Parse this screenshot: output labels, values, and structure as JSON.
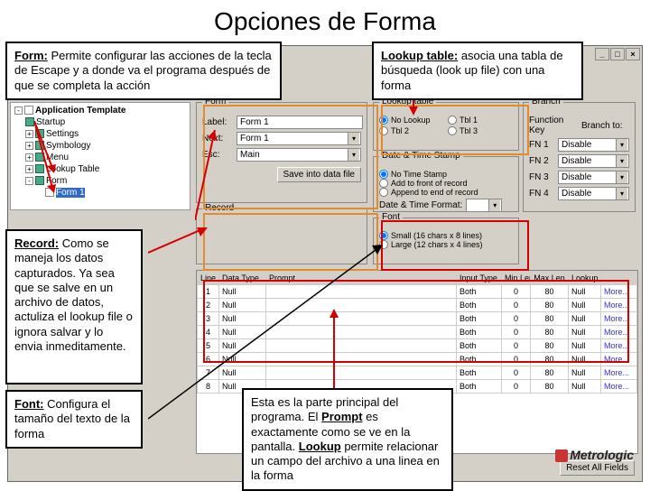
{
  "title": "Opciones de Forma",
  "callouts": {
    "form": {
      "head": "Form:",
      "body": " Permite configurar las acciones de la tecla de Escape y a donde va el programa después de que se completa la acción"
    },
    "lookup": {
      "head": "Lookup table:",
      "body": " asocia una tabla de búsqueda (look up file) con una forma"
    },
    "record": {
      "head": "Record:",
      "body": " Como se maneja los datos capturados. Ya sea que se salve en un archivo de datos, actuliza el lookup file o ignora salvar y lo envia inmeditamente."
    },
    "font": {
      "head": "Font:",
      "body": " Configura el tamaño del texto de la forma"
    },
    "main": {
      "body1": "Esta es la parte principal del programa. El ",
      "b1": "Prompt",
      "body2": " es exactamente como se ve en la pantalla. ",
      "b2": "Lookup",
      "body3": " permite relacionar un campo del archivo a una linea en la forma"
    }
  },
  "tree": {
    "root": "Application Template",
    "items": [
      "Startup",
      "Settings",
      "Symbology",
      "Menu",
      "Lookup Table",
      "Form"
    ],
    "selected": "Form 1"
  },
  "form_group": {
    "legend": "Form",
    "label_row": {
      "lbl": "Label:",
      "val": "Form 1"
    },
    "next_row": {
      "lbl": "Next:",
      "val": "Form 1"
    },
    "esc_row": {
      "lbl": "Esc:",
      "val": "Main"
    },
    "save_btn": "Save into data file"
  },
  "lookup_group": {
    "legend": "Lookup table",
    "opts": [
      "No Lookup",
      "Tbl 1",
      "Tbl 2",
      "Tbl 3"
    ]
  },
  "branch_group": {
    "legend": "Branch",
    "hdr_key": "Function Key",
    "hdr_br": "Branch to:",
    "rows": [
      [
        "FN 1",
        "Disable"
      ],
      [
        "FN 2",
        "Disable"
      ],
      [
        "FN 3",
        "Disable"
      ],
      [
        "FN 4",
        "Disable"
      ]
    ]
  },
  "dt_group": {
    "legend": "Date & Time Stamp",
    "opts": [
      "No Time Stamp",
      "Add to front of record",
      "Append to end of record"
    ],
    "dtf_lbl": "Date & Time Format:"
  },
  "record_group": {
    "legend": "Record"
  },
  "font_group": {
    "legend": "Font",
    "opts": [
      "Small (16 chars x 8 lines)",
      "Large (12 chars x 4 lines)"
    ]
  },
  "table": {
    "headers": [
      "Line",
      "Data Type",
      "Prompt",
      "Input Type",
      "Min Len",
      "Max Len",
      "Lookup",
      ""
    ],
    "rows": [
      [
        "1",
        "Null",
        "",
        "Both",
        "0",
        "80",
        "Null",
        "More..."
      ],
      [
        "2",
        "Null",
        "",
        "Both",
        "0",
        "80",
        "Null",
        "More..."
      ],
      [
        "3",
        "Null",
        "",
        "Both",
        "0",
        "80",
        "Null",
        "More..."
      ],
      [
        "4",
        "Null",
        "",
        "Both",
        "0",
        "80",
        "Null",
        "More..."
      ],
      [
        "5",
        "Null",
        "",
        "Both",
        "0",
        "80",
        "Null",
        "More..."
      ],
      [
        "6",
        "Null",
        "",
        "Both",
        "0",
        "80",
        "Null",
        "More..."
      ],
      [
        "7",
        "Null",
        "",
        "Both",
        "0",
        "80",
        "Null",
        "More..."
      ],
      [
        "8",
        "Null",
        "",
        "Both",
        "0",
        "80",
        "Null",
        "More..."
      ]
    ]
  },
  "reset_btn": "Reset All Fields",
  "logo": "Metrologic"
}
